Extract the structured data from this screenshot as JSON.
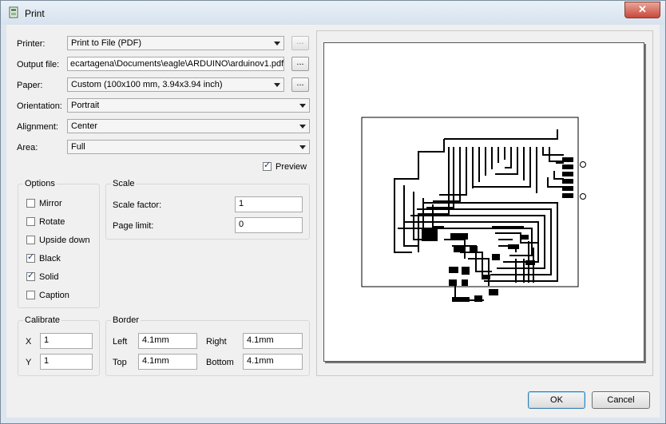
{
  "window": {
    "title": "Print",
    "close_label": "✕"
  },
  "labels": {
    "printer": "Printer:",
    "output_file": "Output file:",
    "paper": "Paper:",
    "orientation": "Orientation:",
    "alignment": "Alignment:",
    "area": "Area:"
  },
  "fields": {
    "printer": "Print to File (PDF)",
    "output_file": "ecartagena\\Documents\\eagle\\ARDUINO\\arduinov1.pdf",
    "paper": "Custom (100x100 mm, 3.94x3.94 inch)",
    "orientation": "Portrait",
    "alignment": "Center",
    "area": "Full",
    "browse_label": "..."
  },
  "preview": {
    "label": "Preview",
    "checked": true
  },
  "options": {
    "title": "Options",
    "items": [
      {
        "label": "Mirror",
        "checked": false
      },
      {
        "label": "Rotate",
        "checked": false
      },
      {
        "label": "Upside down",
        "checked": false
      },
      {
        "label": "Black",
        "checked": true
      },
      {
        "label": "Solid",
        "checked": true
      },
      {
        "label": "Caption",
        "checked": false
      }
    ]
  },
  "scale": {
    "title": "Scale",
    "factor_label": "Scale factor:",
    "factor": "1",
    "page_limit_label": "Page limit:",
    "page_limit": "0"
  },
  "calibrate": {
    "title": "Calibrate",
    "x_label": "X",
    "x": "1",
    "y_label": "Y",
    "y": "1"
  },
  "border": {
    "title": "Border",
    "left_label": "Left",
    "left": "4.1mm",
    "right_label": "Right",
    "right": "4.1mm",
    "top_label": "Top",
    "top": "4.1mm",
    "bottom_label": "Bottom",
    "bottom": "4.1mm"
  },
  "buttons": {
    "ok": "OK",
    "cancel": "Cancel"
  },
  "check_mark": "✓"
}
